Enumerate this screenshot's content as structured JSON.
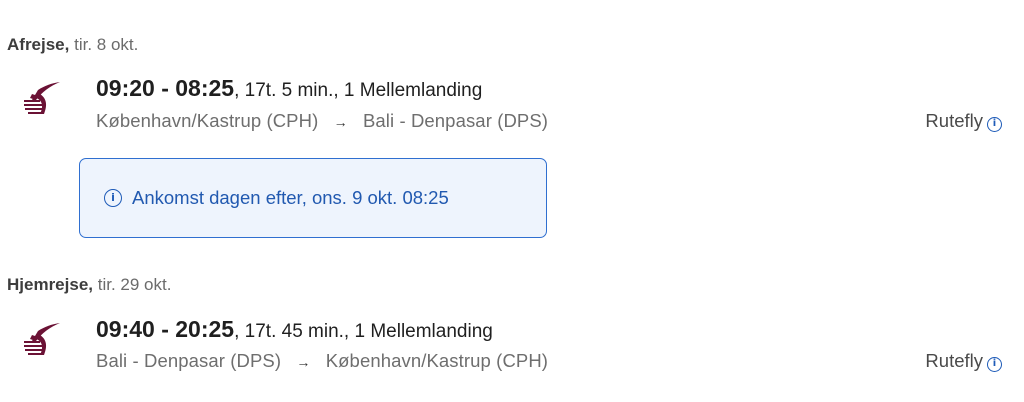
{
  "outbound": {
    "label": "Afrejse,",
    "date": "tir. 8 okt.",
    "times": "09:20 - 08:25",
    "details": ", 17t. 5 min., 1 Mellemlanding",
    "from": "København/Kastrup  (CPH)",
    "arrow": "→",
    "to": "Bali - Denpasar  (DPS)",
    "fare_type": "Rutefly",
    "notice": "Ankomst dagen efter, ons. 9 okt. 08:25"
  },
  "return": {
    "label": "Hjemrejse,",
    "date": "tir. 29 okt.",
    "times": "09:40 - 20:25",
    "details": ", 17t. 45 min., 1 Mellemlanding",
    "from": "Bali - Denpasar  (DPS)",
    "arrow": "→",
    "to": "København/Kastrup  (CPH)",
    "fare_type": "Rutefly"
  },
  "colors": {
    "accent": "#2f6fd0",
    "notice_bg": "#eef4fd",
    "airline": "#6b1235"
  },
  "icons": {
    "info": "info-icon",
    "airline": "airline-logo"
  }
}
